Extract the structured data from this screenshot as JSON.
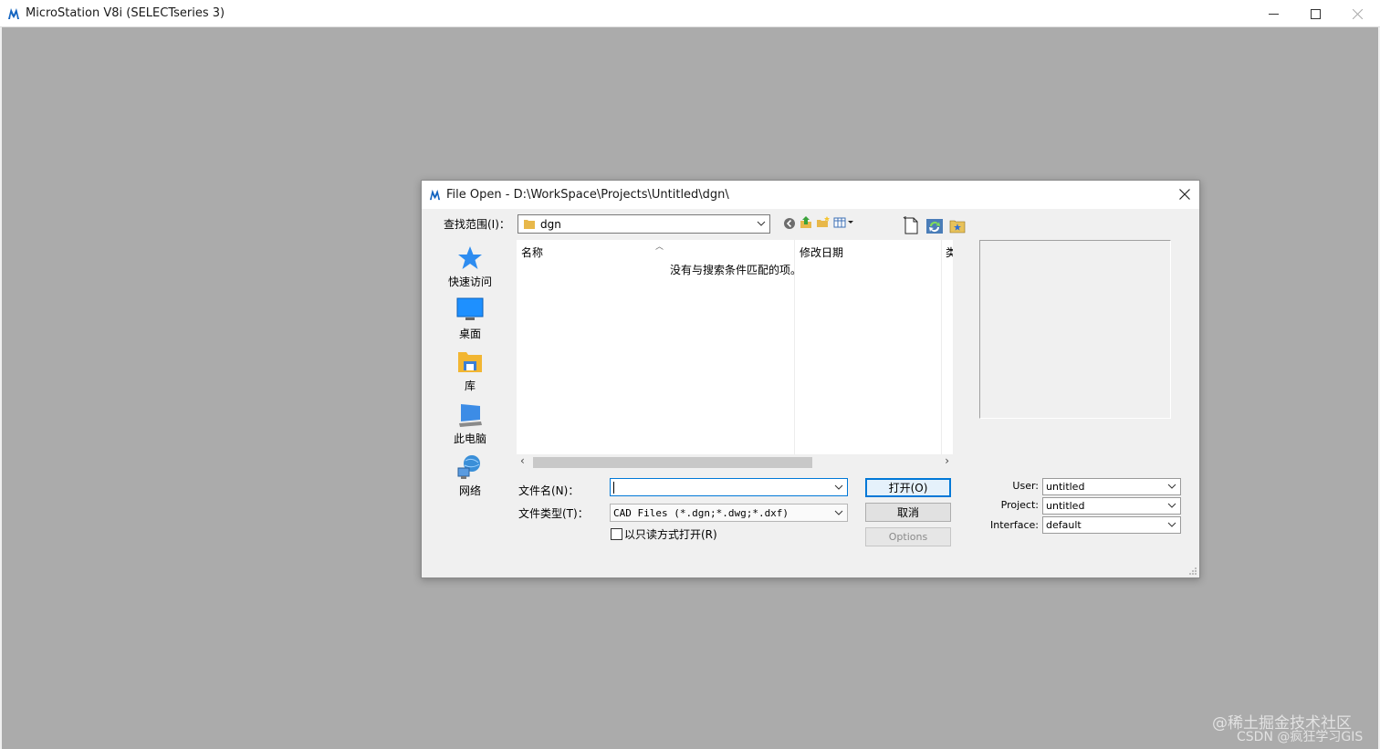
{
  "window": {
    "title": "MicroStation V8i (SELECTseries 3)",
    "minimize": "—",
    "maximize": "☐",
    "close": "✕"
  },
  "dialog": {
    "title": "File Open - D:\\WorkSpace\\Projects\\Untitled\\dgn\\",
    "close": "✕",
    "lookin_label": "查找范围(I)：",
    "lookin_value": "dgn",
    "places": [
      {
        "label": "快速访问",
        "icon": "star-icon"
      },
      {
        "label": "桌面",
        "icon": "desktop-icon"
      },
      {
        "label": "库",
        "icon": "library-icon"
      },
      {
        "label": "此电脑",
        "icon": "computer-icon"
      },
      {
        "label": "网络",
        "icon": "network-icon"
      }
    ],
    "columns": [
      "名称",
      "修改日期",
      "类"
    ],
    "empty_message": "没有与搜索条件匹配的项。",
    "filename_label": "文件名(N)：",
    "filename_value": "",
    "filetype_label": "文件类型(T)：",
    "filetype_value": "CAD Files (*.dgn;*.dwg;*.dxf)",
    "readonly_label": "以只读方式打开(R)",
    "open_button": "打开(O)",
    "cancel_button": "取消",
    "options_button": "Options",
    "user_label": "User:",
    "user_value": "untitled",
    "project_label": "Project:",
    "project_value": "untitled",
    "interface_label": "Interface:",
    "interface_value": "default"
  },
  "watermarks": {
    "line1": "@稀土掘金技术社区",
    "line2": "CSDN @疯狂学习GIS"
  }
}
